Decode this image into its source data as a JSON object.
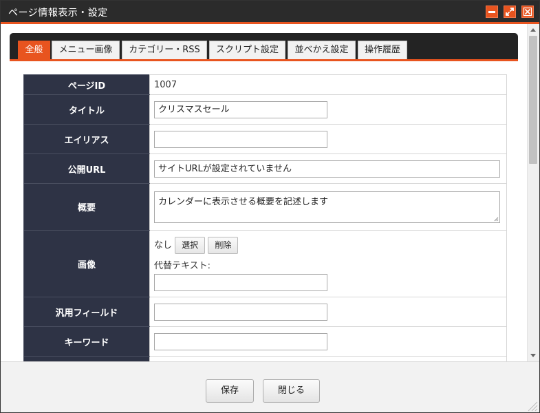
{
  "window": {
    "title": "ページ情報表示・設定",
    "controls": [
      "minimize-icon",
      "maximize-icon",
      "close-icon"
    ]
  },
  "tabs": [
    {
      "label": "全般",
      "active": true
    },
    {
      "label": "メニュー画像",
      "active": false
    },
    {
      "label": "カテゴリー・RSS",
      "active": false
    },
    {
      "label": "スクリプト設定",
      "active": false
    },
    {
      "label": "並べかえ設定",
      "active": false
    },
    {
      "label": "操作履歴",
      "active": false
    }
  ],
  "form": {
    "page_id": {
      "label": "ページID",
      "value": "1007"
    },
    "title": {
      "label": "タイトル",
      "value": "クリスマスセール"
    },
    "alias": {
      "label": "エイリアス",
      "value": ""
    },
    "public_url": {
      "label": "公開URL",
      "value": "サイトURLが設定されていません"
    },
    "summary": {
      "label": "概要",
      "value": "カレンダーに表示させる概要を記述します"
    },
    "image": {
      "label": "画像",
      "status": "なし",
      "select_button": "選択",
      "delete_button": "削除",
      "alt_label": "代替テキスト:",
      "alt_value": ""
    },
    "generic_field": {
      "label": "汎用フィールド",
      "value": ""
    },
    "keywords": {
      "label": "キーワード",
      "value": ""
    }
  },
  "footer": {
    "save_label": "保存",
    "close_label": "閉じる"
  },
  "colors": {
    "accent": "#e8541f",
    "titlebar": "#2b2b2b",
    "label_bg": "#2e3345"
  }
}
